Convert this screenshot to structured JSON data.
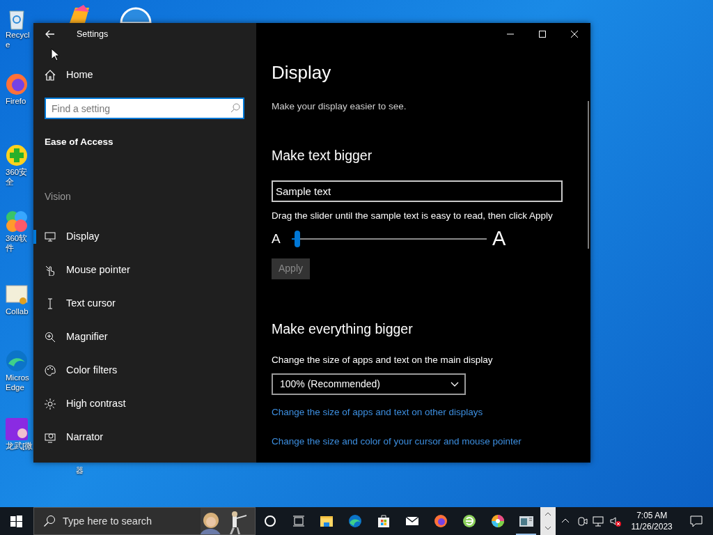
{
  "desktop_icons": [
    {
      "label": "Recycle"
    },
    {
      "label": "Firefo"
    },
    {
      "label": "360安全"
    },
    {
      "label": "360软件"
    },
    {
      "label": "Collab"
    },
    {
      "label": "Micros Edge"
    },
    {
      "label": "龙武[微"
    }
  ],
  "desktop_stray_text": "器",
  "window": {
    "title": "Settings",
    "home": "Home",
    "search": {
      "placeholder": "Find a setting"
    },
    "section": "Ease of Access",
    "group": "Vision",
    "items": [
      {
        "label": "Display",
        "selected": true
      },
      {
        "label": "Mouse pointer",
        "selected": false
      },
      {
        "label": "Text cursor",
        "selected": false
      },
      {
        "label": "Magnifier",
        "selected": false
      },
      {
        "label": "Color filters",
        "selected": false
      },
      {
        "label": "High contrast",
        "selected": false
      },
      {
        "label": "Narrator",
        "selected": false
      }
    ]
  },
  "content": {
    "title": "Display",
    "subtitle": "Make your display easier to see.",
    "text_size": {
      "heading": "Make text bigger",
      "sample": "Sample text",
      "hint": "Drag the slider until the sample text is easy to read, then click Apply",
      "small_label": "A",
      "large_label": "A",
      "level": 0.02,
      "apply": {
        "label": "Apply",
        "disabled": true
      }
    },
    "everything": {
      "heading": "Make everything bigger",
      "label": "Change the size of apps and text on the main display",
      "dropdown": "100% (Recommended)",
      "links": [
        "Change the size of apps and text on other displays",
        "Change the size and color of your cursor and mouse pointer"
      ]
    }
  },
  "taskbar": {
    "search": {
      "placeholder": "Type here to search"
    },
    "apps": [
      {
        "running": false
      },
      {
        "running": false
      },
      {
        "running": false
      },
      {
        "running": false
      },
      {
        "running": false
      },
      {
        "running": false
      },
      {
        "running": false
      },
      {
        "running": false
      },
      {
        "running": false
      },
      {
        "running": true
      }
    ],
    "time": "7:05 AM",
    "date": "11/26/2023"
  }
}
